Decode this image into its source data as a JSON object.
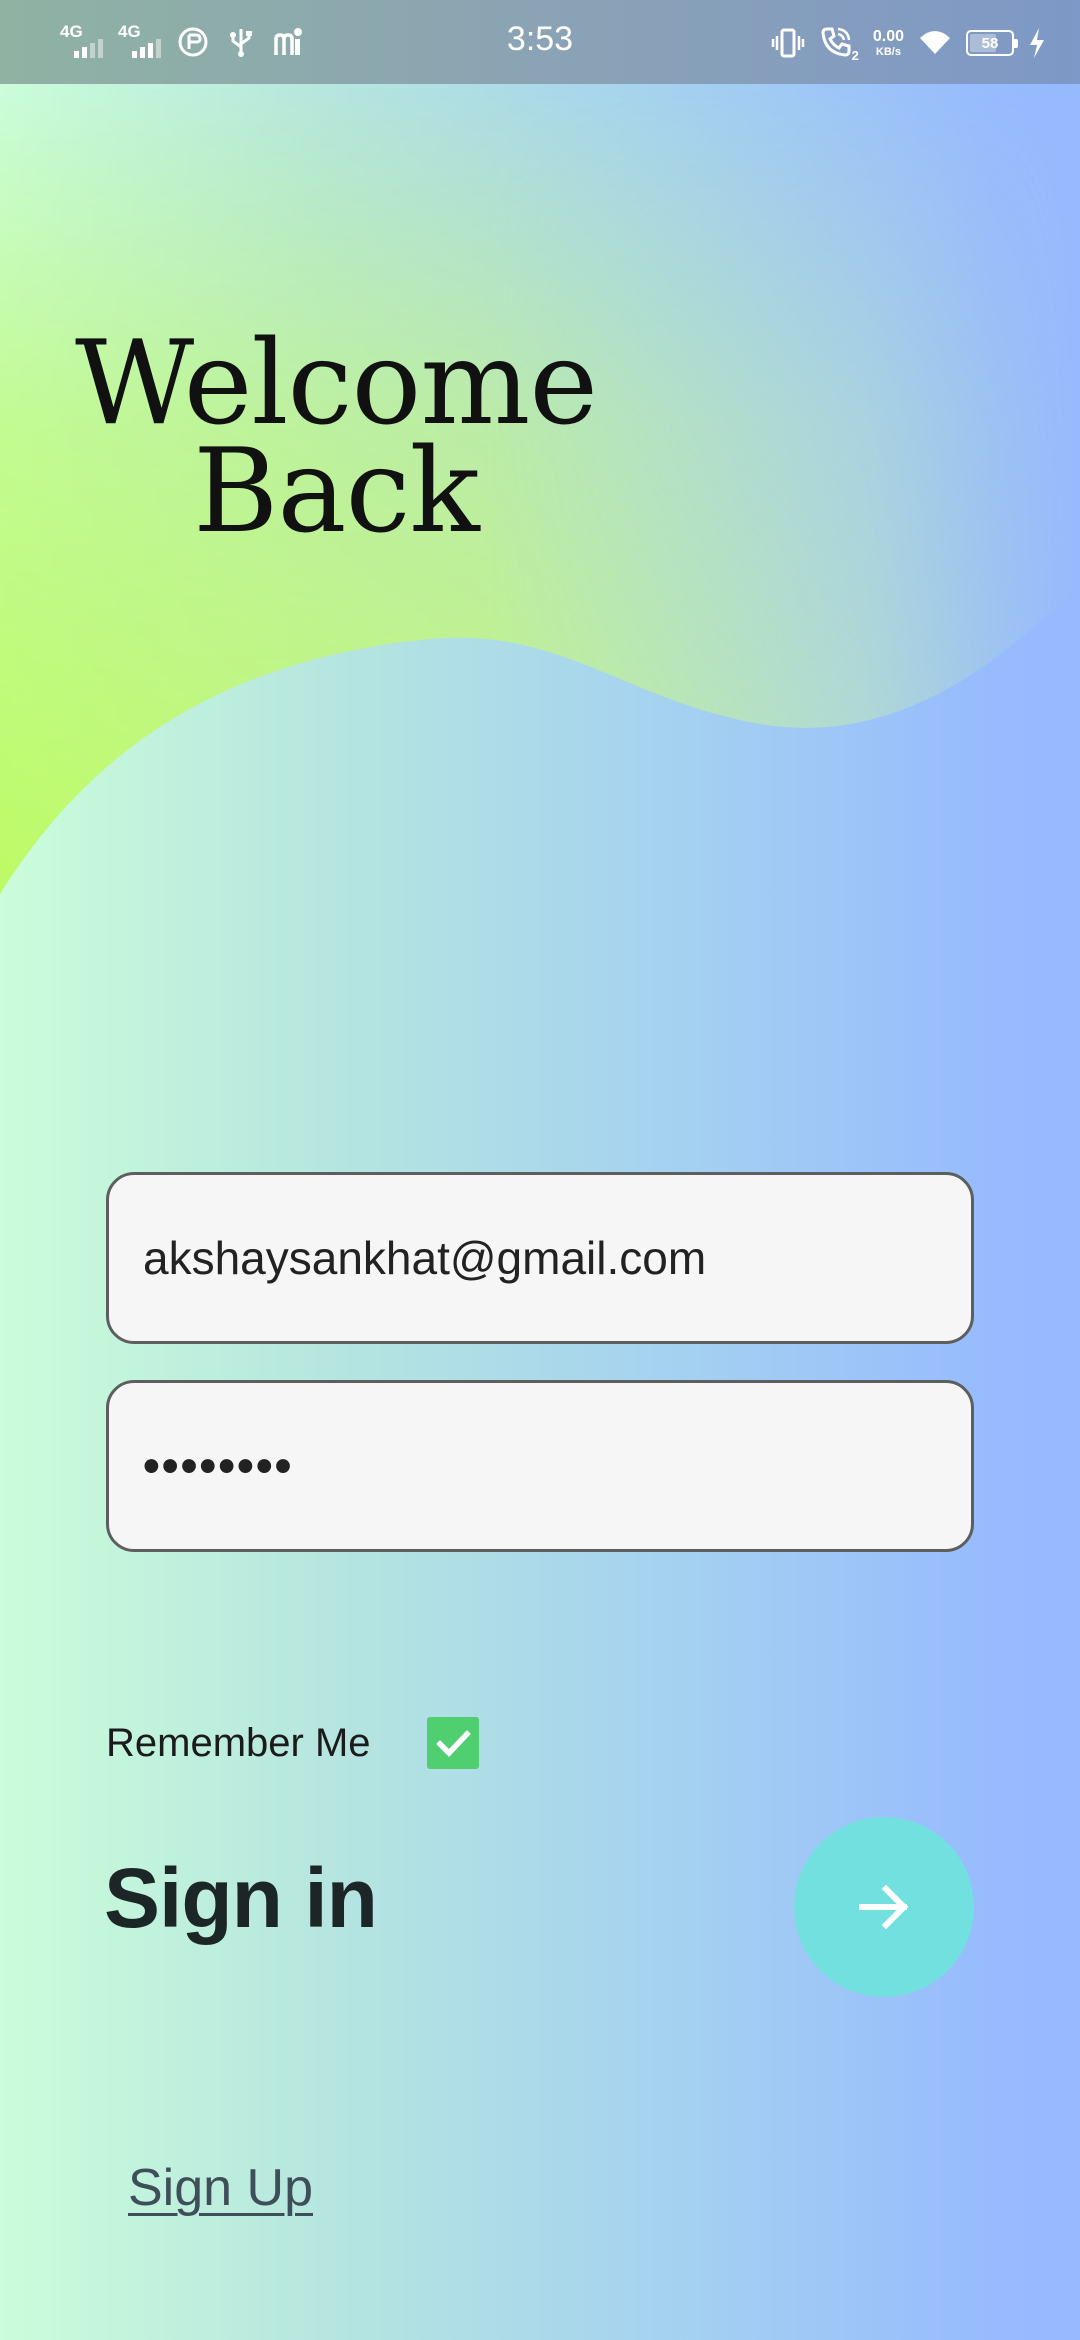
{
  "status_bar": {
    "time": "3:53",
    "network_1": "4G",
    "network_2": "4G",
    "data_speed_value": "0.00",
    "data_speed_unit": "KB/s",
    "call_sim": "2",
    "battery_level": "58"
  },
  "header": {
    "welcome_line1": "Welcome",
    "welcome_line2": "Back"
  },
  "form": {
    "email_value": "akshaysankhat@gmail.com",
    "password_value": "••••••••",
    "remember_label": "Remember Me",
    "remember_checked": true
  },
  "actions": {
    "signin_label": "Sign in",
    "signup_label": "Sign Up"
  },
  "colors": {
    "accent_button": "#73e0e0",
    "checkbox": "#4fcf70",
    "wave": "#bdf86f"
  },
  "icons": {
    "go": "arrow-right-icon",
    "check": "check-icon"
  }
}
